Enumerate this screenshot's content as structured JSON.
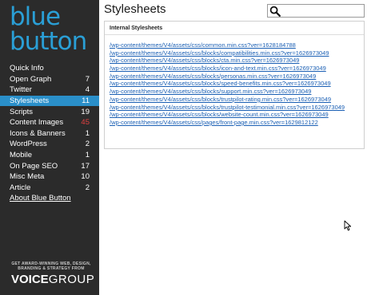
{
  "sidebar": {
    "logo": {
      "line1": "blue",
      "line2": "button"
    },
    "items": [
      {
        "label": "Quick Info",
        "count": ""
      },
      {
        "label": "Open Graph",
        "count": "7"
      },
      {
        "label": "Twitter",
        "count": "4"
      },
      {
        "label": "Stylesheets",
        "count": "11"
      },
      {
        "label": "Scripts",
        "count": "19"
      },
      {
        "label": "Content Images",
        "count": "45"
      },
      {
        "label": "Icons & Banners",
        "count": "1"
      },
      {
        "label": "WordPress",
        "count": "2"
      },
      {
        "label": "Mobile",
        "count": "1"
      },
      {
        "label": "On Page SEO",
        "count": "17"
      },
      {
        "label": "Misc Meta",
        "count": "10"
      },
      {
        "label": "Article",
        "count": "2"
      },
      {
        "label": "About Blue Button",
        "count": ""
      }
    ],
    "active_item": "Stylesheets",
    "footer": {
      "tagline": "GET AWARD-WINNING WEB, DESIGN, BRANDING & STRATEGY FROM",
      "brand_bold": "VOICE",
      "brand_thin": "GROUP"
    }
  },
  "main": {
    "title": "Stylesheets",
    "search": {
      "value": "",
      "icon": "search-icon"
    },
    "panel": {
      "heading": "Internal Stylesheets",
      "links": [
        "/wp-content/themes/V4/assets/css/common.min.css?ver=1628184788",
        "/wp-content/themes/V4/assets/css/blocks/compatibilities.min.css?ver=1626973049",
        "/wp-content/themes/V4/assets/css/blocks/cta.min.css?ver=1626973049",
        "/wp-content/themes/V4/assets/css/blocks/icon-and-text.min.css?ver=1626973049",
        "/wp-content/themes/V4/assets/css/blocks/personas.min.css?ver=1626973049",
        "/wp-content/themes/V4/assets/css/blocks/speed-benefits.min.css?ver=1626973049",
        "/wp-content/themes/V4/assets/css/blocks/support.min.css?ver=1626973049",
        "/wp-content/themes/V4/assets/css/blocks/trustpilot-rating.min.css?ver=1626973049",
        "/wp-content/themes/V4/assets/css/blocks/trustpilot-testimonial.min.css?ver=1626973049",
        "/wp-content/themes/V4/assets/css/blocks/website-count.min.css?ver=1626973049",
        "/wp-content/themes/V4/assets/css/pages/front-page.min.css?ver=1629812122"
      ]
    }
  },
  "colors": {
    "sidebar_bg": "#2b2b2b",
    "accent": "#2a8fc9",
    "logo": "#2a9fd6",
    "alert_count": "#e04040",
    "link": "#1a5fb4"
  }
}
